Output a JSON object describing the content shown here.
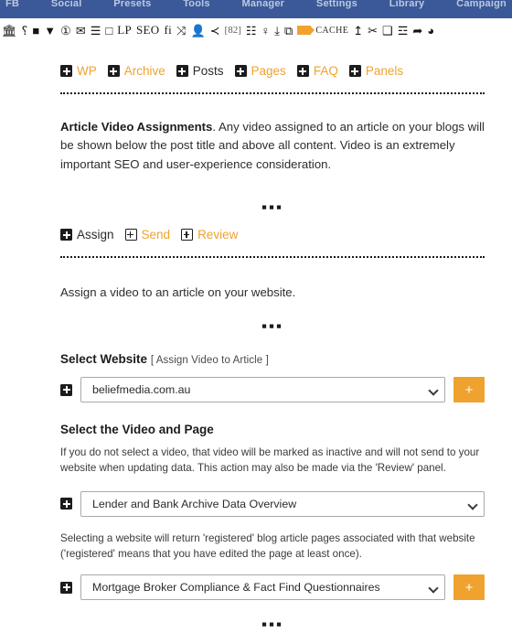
{
  "topnav": {
    "items": [
      {
        "label": "FB"
      },
      {
        "label": "Social"
      },
      {
        "label": "Presets"
      },
      {
        "label": "Tools"
      },
      {
        "label": "Manager"
      },
      {
        "label": "Settings"
      },
      {
        "label": "Library"
      },
      {
        "label": "Campaign"
      }
    ]
  },
  "toolbar": {
    "items": [
      {
        "name": "bank-icon",
        "type": "icon",
        "glyph": "🏛"
      },
      {
        "name": "plug-icon",
        "type": "icon",
        "glyph": "⸮"
      },
      {
        "name": "box-icon",
        "type": "icon",
        "glyph": "■"
      },
      {
        "name": "filter-funnel-icon",
        "type": "icon",
        "glyph": "▼"
      },
      {
        "name": "info-circle-icon",
        "type": "icon",
        "glyph": "①"
      },
      {
        "name": "inbox-icon",
        "type": "icon",
        "glyph": "✉"
      },
      {
        "name": "list-icon",
        "type": "icon",
        "glyph": "☰"
      },
      {
        "name": "frame-icon",
        "type": "icon",
        "glyph": "□"
      },
      {
        "name": "landing-page-label",
        "type": "text",
        "label": "LP"
      },
      {
        "name": "seo-label",
        "type": "text",
        "label": "SEO"
      },
      {
        "name": "fi-label",
        "type": "text",
        "label": "fi"
      },
      {
        "name": "shuffle-icon",
        "type": "icon",
        "glyph": "⤨"
      },
      {
        "name": "user-icon",
        "type": "icon",
        "glyph": "👤"
      },
      {
        "name": "share-icon",
        "type": "icon",
        "glyph": "≺"
      },
      {
        "name": "count-badge",
        "type": "badge",
        "label": "[82]"
      },
      {
        "name": "form-icon",
        "type": "icon",
        "glyph": "☷"
      },
      {
        "name": "location-pin-icon",
        "type": "icon",
        "glyph": "♀"
      },
      {
        "name": "download-icon",
        "type": "icon",
        "glyph": "⤓"
      },
      {
        "name": "share-box-icon",
        "type": "icon",
        "glyph": "⧉"
      },
      {
        "name": "video-camera-icon",
        "type": "video"
      },
      {
        "name": "cache-label",
        "type": "cache",
        "label": "CACHE"
      },
      {
        "name": "file-upload-icon",
        "type": "icon",
        "glyph": "↥"
      },
      {
        "name": "scissors-icon",
        "type": "icon",
        "glyph": "✂"
      },
      {
        "name": "archive-box-icon",
        "type": "icon",
        "glyph": "❑"
      },
      {
        "name": "bullet-list-icon",
        "type": "icon",
        "glyph": "☲"
      },
      {
        "name": "forward-arrow-icon",
        "type": "icon",
        "glyph": "➦"
      },
      {
        "name": "pie-chart-icon",
        "type": "icon",
        "glyph": "◕"
      }
    ]
  },
  "breadcrumb_tabs": [
    {
      "label": "WP",
      "state": "link"
    },
    {
      "label": "Archive",
      "state": "link"
    },
    {
      "label": "Posts",
      "state": "active"
    },
    {
      "label": "Pages",
      "state": "link"
    },
    {
      "label": "FAQ",
      "state": "link"
    },
    {
      "label": "Panels",
      "state": "link"
    }
  ],
  "intro": {
    "bold": "Article Video Assignments",
    "text": ". Any video assigned to an article on your blogs will be shown below the post title and above all content. Video is an extremely important SEO and user-experience consideration."
  },
  "separator_dots": "▪▪▪",
  "action_tabs": [
    {
      "label": "Assign",
      "state": "active"
    },
    {
      "label": "Send",
      "state": "link"
    },
    {
      "label": "Review",
      "state": "link"
    }
  ],
  "assign_line": "Assign a video to an article on your website.",
  "select_website": {
    "heading": "Select Website",
    "subheading": "[ Assign Video to Article ]",
    "value": "beliefmedia.com.au",
    "options": [
      "beliefmedia.com.au"
    ],
    "add_button_label": "+"
  },
  "select_video_page": {
    "heading": "Select the Video and Page",
    "note": "If you do not select a video, that video will be marked as inactive and will not send to your website when updating data. This action may also be made via the 'Review' panel.",
    "video_value": "Lender and Bank Archive Data Overview",
    "video_options": [
      "Lender and Bank Archive Data Overview"
    ],
    "registered_note": "Selecting a website will return 'registered' blog article pages associated with that website ('registered' means that you have edited the page at least once).",
    "page_value": "Mortgage Broker Compliance & Fact Find Questionnaires",
    "page_options": [
      "Mortgage Broker Compliance & Fact Find Questionnaires"
    ],
    "add_button_label": "+"
  },
  "colors": {
    "navbar": "#3b5998",
    "accent_orange": "#f0a22e",
    "text": "#2d2d2d"
  }
}
